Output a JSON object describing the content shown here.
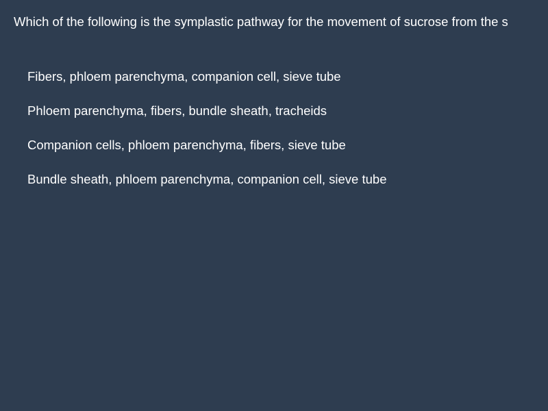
{
  "question": {
    "text": "Which of the following is the symplastic pathway for the movement of sucrose from the s"
  },
  "options": [
    {
      "label": "Fibers, phloem parenchyma, companion cell, sieve tube"
    },
    {
      "label": "Phloem parenchyma, fibers, bundle sheath, tracheids"
    },
    {
      "label": "Companion cells, phloem parenchyma, fibers, sieve tube"
    },
    {
      "label": "Bundle sheath, phloem parenchyma, companion cell, sieve tube"
    }
  ],
  "colors": {
    "background": "#2e3d50",
    "text": "#ffffff"
  }
}
